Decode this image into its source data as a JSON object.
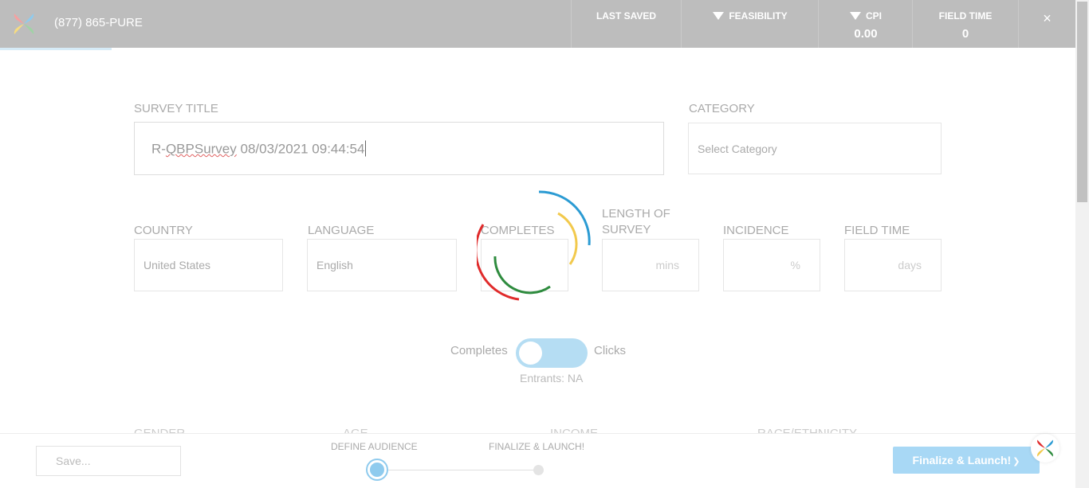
{
  "header": {
    "phone": "(877) 865-PURE",
    "last_saved_label": "LAST SAVED",
    "feasibility_label": "FEASIBILITY",
    "cpi_label": "CPI",
    "cpi_value": "0.00",
    "field_time_label": "FIELD TIME",
    "field_time_value": "0",
    "close_glyph": "×"
  },
  "form": {
    "survey_title_label": "SURVEY TITLE",
    "survey_title_prefix": "R-",
    "survey_title_word": "QBPSurvey",
    "survey_title_rest": " 08/03/2021 09:44:54",
    "category_label": "CATEGORY",
    "category_placeholder": "Select Category",
    "country_label": "COUNTRY",
    "country_value": "United States",
    "language_label": "LANGUAGE",
    "language_value": "English",
    "completes_label": "COMPLETES",
    "length_label_line1": "LENGTH OF",
    "length_label_line2": "SURVEY",
    "length_unit": "mins",
    "incidence_label": "INCIDENCE",
    "incidence_unit": "%",
    "field_time_label": "FIELD TIME",
    "field_time_unit": "days"
  },
  "toggle": {
    "left_label": "Completes",
    "right_label": "Clicks",
    "entrants": "Entrants: NA"
  },
  "next_section": {
    "gender": "GENDER",
    "age": "AGE",
    "income": "INCOME",
    "race": "RACE/ETHNICITY"
  },
  "footer": {
    "save_placeholder": "Save...",
    "step1_label": "DEFINE AUDIENCE",
    "step2_label": "FINALIZE & LAUNCH!",
    "launch_button": "Finalize & Launch!",
    "launch_glyph": "❯"
  },
  "colors": {
    "header_bg": "#bdbdbd",
    "accent": "#a8d8f5",
    "spinner": [
      "#2b9bd3",
      "#f2c94c",
      "#2e8b3e",
      "#e02b2b"
    ]
  },
  "icons": [
    "logo-icon",
    "filter-triangle-icon",
    "close-icon",
    "loading-spinner-icon",
    "chat-logo-icon"
  ]
}
